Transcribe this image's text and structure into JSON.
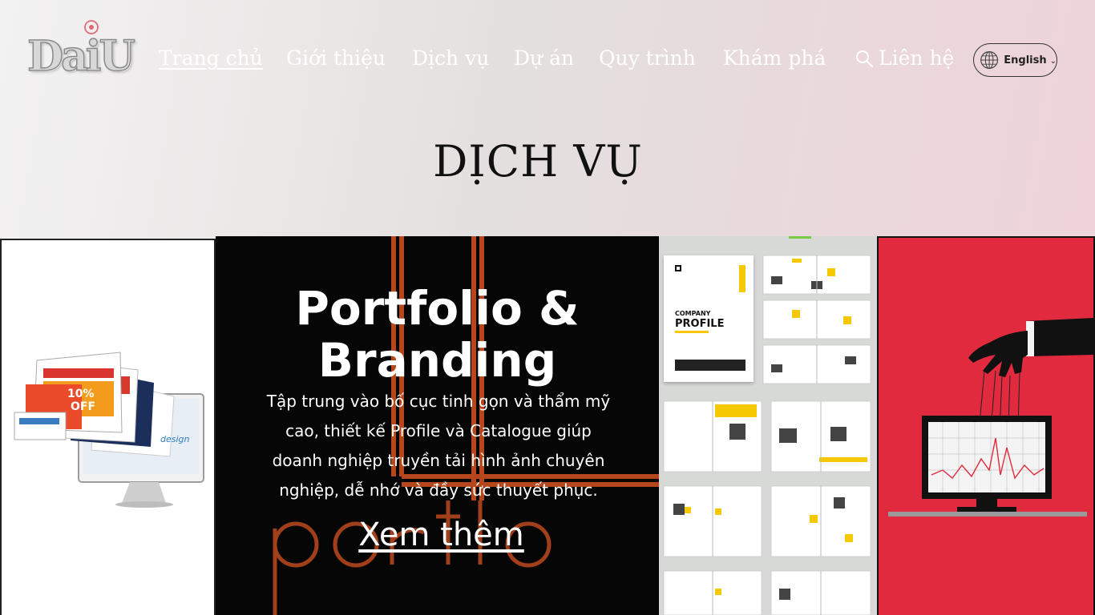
{
  "brand": {
    "logo_text": "DaiU"
  },
  "nav": {
    "items": [
      {
        "label": "Trang chủ",
        "active": true
      },
      {
        "label": "Giới thiệu"
      },
      {
        "label": "Dịch vụ"
      },
      {
        "label": "Dự án"
      },
      {
        "label": "Quy trình"
      },
      {
        "label": "Khám phá"
      },
      {
        "label": "Liên hệ"
      }
    ],
    "search_icon": "search-icon",
    "language": {
      "label": "English",
      "icon": "globe-icon",
      "chevron": "⌄"
    }
  },
  "page": {
    "title": "DỊCH VỤ"
  },
  "cards": {
    "portfolio": {
      "title_line1": "Portfolio &",
      "title_line2": "Branding",
      "description": "Tập trung vào bố cục tinh gọn và thẩm mỹ cao, thiết kế Profile và Catalogue giúp doanh nghiệp truyền tải hình ảnh chuyên nghiệp, dễ nhớ và đầy sức thuyết phục.",
      "more_link": "Xem thêm",
      "background_word": "portfolio"
    },
    "web": {
      "image_text_1": "10%",
      "image_text_2": "OFF",
      "image_text_3": "design"
    },
    "profile": {
      "cover_line1": "COMPANY",
      "cover_line2": "PROFILE",
      "cover_tag": "PROFILE"
    }
  },
  "colors": {
    "nav_text": "#ffffff",
    "accent_yellow": "#f5c800",
    "puppet_red": "#e22a3f",
    "portfolio_orange": "#b6471c"
  }
}
